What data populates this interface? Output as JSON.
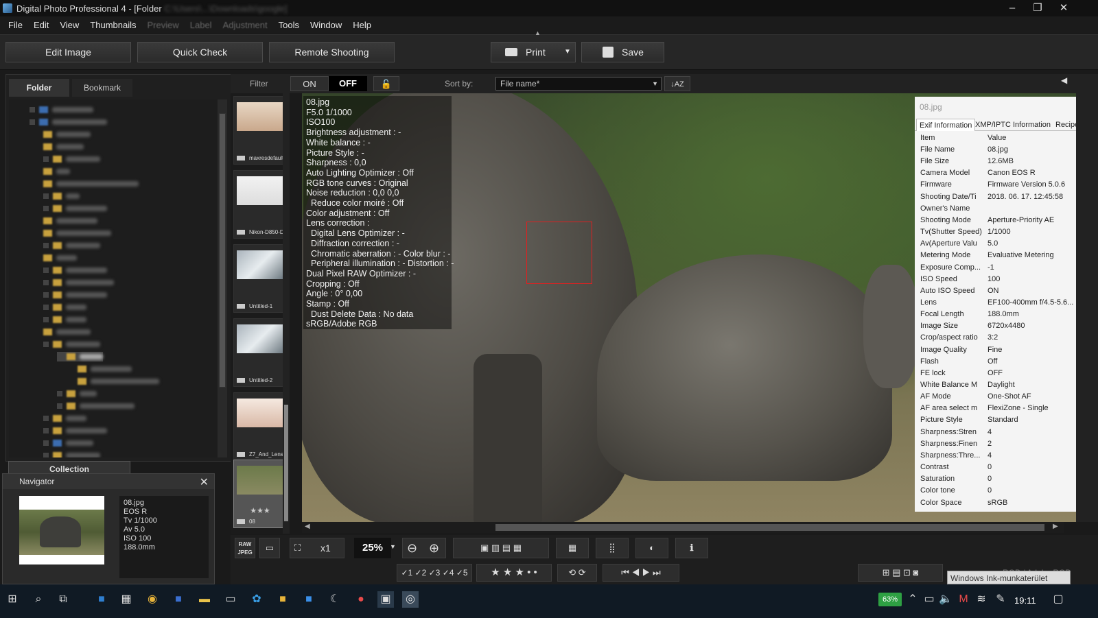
{
  "window": {
    "title_prefix": "Digital Photo Professional 4 - [Folder",
    "title_path": " C:\\Users\\...\\Downloads\\google]",
    "minimize": "–",
    "maximize": "❐",
    "close": "✕"
  },
  "menu": {
    "file": "File",
    "edit": "Edit",
    "view": "View",
    "thumbnails": "Thumbnails",
    "preview": "Preview",
    "label": "Label",
    "adjustment": "Adjustment",
    "tools": "Tools",
    "window": "Window",
    "help": "Help"
  },
  "toolbar": {
    "edit_image": "Edit Image",
    "quick_check": "Quick Check",
    "remote_shooting": "Remote Shooting",
    "print": "Print",
    "save": "Save"
  },
  "left_panel": {
    "tab_folder": "Folder",
    "tab_bookmark": "Bookmark",
    "collection": "Collection"
  },
  "navigator": {
    "title": "Navigator",
    "info": [
      "08.jpg",
      "EOS R",
      "Tv 1/1000",
      "Av 5.0",
      "ISO 100",
      "188.0mm"
    ]
  },
  "filter": {
    "label": "Filter",
    "on": "ON",
    "off": "OFF",
    "sort_label": "Sort by:",
    "sort_value": "File name*"
  },
  "thumbnails": [
    {
      "label": "maxresdefault"
    },
    {
      "label": "Nikon-D850-DS..."
    },
    {
      "label": "Untitled-1"
    },
    {
      "label": "Untitled-2"
    },
    {
      "label": "Z7_And_Lenses..."
    },
    {
      "label": "08",
      "stars": "★★★"
    }
  ],
  "info_overlay": [
    "08.jpg",
    "F5.0 1/1000",
    "ISO100",
    "Brightness adjustment : -",
    "White balance : -",
    "Picture Style : -",
    "Sharpness : 0,0",
    "Auto Lighting Optimizer : Off",
    "RGB tone curves : Original",
    "Noise reduction : 0,0 0,0",
    "  Reduce color moiré : Off",
    "Color adjustment : Off",
    "Lens correction :",
    "  Digital Lens Optimizer : -",
    "  Diffraction correction : -",
    "  Chromatic aberration : - Color blur : -",
    "  Peripheral illumination : - Distortion : -",
    "Dual Pixel RAW Optimizer : -",
    "Cropping : Off",
    "Angle : 0° 0,00",
    "Stamp : Off",
    "  Dust Delete Data : No data",
    "sRGB/Adobe RGB"
  ],
  "exif": {
    "file": "08.jpg",
    "tabs": [
      "Exif Information",
      "XMP/IPTC Information",
      "Recipe"
    ],
    "header": {
      "k": "Item",
      "v": "Value"
    },
    "rows": [
      {
        "k": "File Name",
        "v": "08.jpg"
      },
      {
        "k": "File Size",
        "v": "12.6MB"
      },
      {
        "k": "Camera Model",
        "v": "Canon EOS R"
      },
      {
        "k": "Firmware",
        "v": "Firmware Version 5.0.6"
      },
      {
        "k": "Shooting Date/Ti",
        "v": "2018. 06. 17. 12:45:58"
      },
      {
        "k": "Owner's Name",
        "v": ""
      },
      {
        "k": "Shooting Mode",
        "v": "Aperture-Priority AE"
      },
      {
        "k": "Tv(Shutter Speed)",
        "v": "1/1000"
      },
      {
        "k": "Av(Aperture Valu",
        "v": "5.0"
      },
      {
        "k": "Metering Mode",
        "v": "Evaluative Metering"
      },
      {
        "k": "Exposure Comp...",
        "v": "-1"
      },
      {
        "k": "ISO Speed",
        "v": "100"
      },
      {
        "k": "Auto ISO Speed",
        "v": "ON"
      },
      {
        "k": "Lens",
        "v": "EF100-400mm f/4.5-5.6..."
      },
      {
        "k": "Focal Length",
        "v": "188.0mm"
      },
      {
        "k": "Image Size",
        "v": "6720x4480"
      },
      {
        "k": "Crop/aspect ratio",
        "v": "3:2"
      },
      {
        "k": "Image Quality",
        "v": "Fine"
      },
      {
        "k": "Flash",
        "v": "Off"
      },
      {
        "k": "FE lock",
        "v": "OFF"
      },
      {
        "k": "White Balance M",
        "v": "Daylight"
      },
      {
        "k": "AF Mode",
        "v": "One-Shot AF"
      },
      {
        "k": "AF area select m",
        "v": "FlexiZone - Single"
      },
      {
        "k": "Picture Style",
        "v": "Standard"
      },
      {
        "k": "Sharpness:Stren",
        "v": "4"
      },
      {
        "k": "Sharpness:Finen",
        "v": "2"
      },
      {
        "k": "Sharpness:Thre...",
        "v": "4"
      },
      {
        "k": "Contrast",
        "v": "0"
      },
      {
        "k": "Saturation",
        "v": "0"
      },
      {
        "k": "Color tone",
        "v": "0"
      },
      {
        "k": "Color Space",
        "v": "sRGB"
      }
    ]
  },
  "bottom": {
    "raw_jpeg": "RAW JPEG",
    "x1": "x1",
    "zoom": "25%",
    "checkmarks": [
      "✓1",
      "✓2",
      "✓3",
      "✓4",
      "✓5"
    ],
    "stars": [
      "★",
      "★",
      "★",
      "•",
      "•"
    ],
    "color_space": "sRGB / Adobe RGB",
    "tooltip": "Windows Ink-munkaterület"
  },
  "taskbar": {
    "battery": "63%",
    "time": "19:11"
  },
  "colors": {
    "accent_red": "#e02020",
    "off_active": "#000000",
    "battery_green": "#2ea043"
  }
}
